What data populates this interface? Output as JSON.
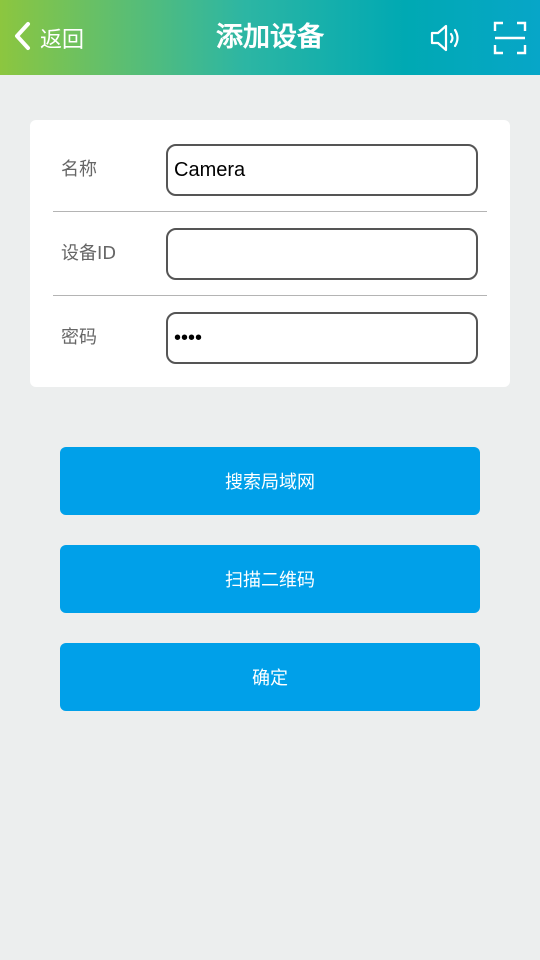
{
  "header": {
    "back_label": "返回",
    "title": "添加设备",
    "icons": [
      "back-chevron-icon",
      "speaker-icon",
      "scan-frame-icon"
    ]
  },
  "form": {
    "name": {
      "label": "名称",
      "value": "Camera"
    },
    "device_id": {
      "label": "设备ID",
      "value": ""
    },
    "password": {
      "label": "密码",
      "value": "1234"
    }
  },
  "buttons": {
    "search_lan": "搜索局域网",
    "scan_qr": "扫描二维码",
    "confirm": "确定"
  },
  "colors": {
    "header_gradient_start": "#8cc63f",
    "header_gradient_end": "#07a6c8",
    "button_blue": "#00a0e9",
    "background": "#eceeee"
  }
}
